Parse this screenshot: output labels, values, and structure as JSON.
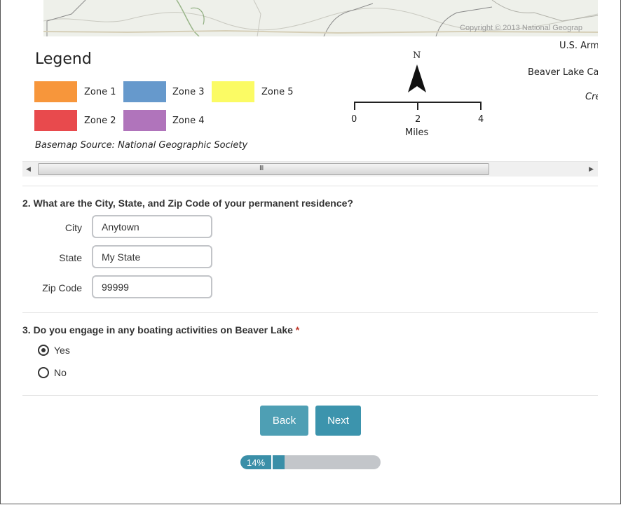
{
  "map": {
    "copyright": "Copyright © 2013 National Geograp",
    "legend_title": "Legend",
    "zones": [
      {
        "label": "Zone 1",
        "color": "#f7963b"
      },
      {
        "label": "Zone 2",
        "color": "#e84a4d"
      },
      {
        "label": "Zone 3",
        "color": "#6699cc"
      },
      {
        "label": "Zone 4",
        "color": "#b074bb"
      },
      {
        "label": "Zone 5",
        "color": "#fbfb64"
      }
    ],
    "basemap_source": "Basemap Source: National Geographic Society",
    "north_label": "N",
    "scale": {
      "ticks": [
        "0",
        "2",
        "4"
      ],
      "unit": "Miles"
    },
    "right_texts": [
      "U.S. Arm",
      "Beaver Lake Car",
      "Cre"
    ],
    "scroll_grip": "III"
  },
  "q2": {
    "question": "2. What are the City, State, and Zip Code of your permanent residence?",
    "fields": [
      {
        "label": "City",
        "value": "Anytown"
      },
      {
        "label": "State",
        "value": "My State"
      },
      {
        "label": "Zip Code",
        "value": "99999"
      }
    ]
  },
  "q3": {
    "question": "3. Do you engage in any boating activities on Beaver Lake",
    "required_marker": "*",
    "options": [
      {
        "label": "Yes",
        "selected": true
      },
      {
        "label": "No",
        "selected": false
      }
    ]
  },
  "nav": {
    "back_label": "Back",
    "next_label": "Next"
  },
  "progress": {
    "label": "14%",
    "value": 0.14
  },
  "colors": {
    "accent": "#3c94ad",
    "button_back": "#4e9fb4",
    "progress_track": "#c3c6ca"
  }
}
